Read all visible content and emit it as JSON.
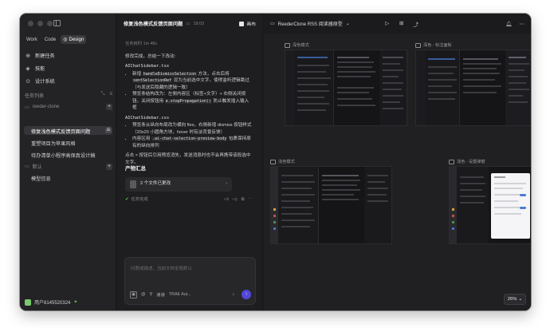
{
  "sidebar": {
    "modes": [
      {
        "label": "Work",
        "active": false
      },
      {
        "label": "Code",
        "active": false
      },
      {
        "label": "Design",
        "active": true
      }
    ],
    "nav": [
      {
        "label": "新建任务",
        "icon": "new-task-icon"
      },
      {
        "label": "技能",
        "icon": "skills-icon"
      },
      {
        "label": "设计系统",
        "icon": "design-system-icon"
      }
    ],
    "tasks_header": "任务列表",
    "groups": [
      {
        "name": "reeder-clone",
        "tasks": [
          "修复浅色模式反馈页面问题",
          "重塑项目为苹果风格",
          "待办清单小程序高保真设计稿"
        ]
      },
      {
        "name": "默认",
        "tasks": [
          "模型信息"
        ]
      }
    ],
    "user_name": "用户8145520324"
  },
  "chat": {
    "title": "修复浅色模式反馈页面问题",
    "time": "18:03",
    "flag_label": "画布",
    "elapsed": "任务耗时 1m 48s",
    "summary": "修改完成。总结一下改动:",
    "file1": "AIChatSidebar.tsx",
    "file1_items": [
      {
        "pre": "新增 ",
        "code1": "handleDismissSelection",
        "mid": " 方法，点击后将 ",
        "code2": "sentSelectionRef",
        "post": " 设为当前选中文字，使得监听逻辑跳过（与发送后隐藏的逻辑一致）"
      },
      {
        "pre": "预览条结构改为：左侧内容区（标签+文字）+ 右侧关闭按钮。关闭按钮用 ",
        "code1": "e.stopPropagation()",
        "mid": "",
        "code2": "",
        "post": " 防止触发插入输入框"
      }
    ],
    "file2": "AIChatSidebar.css",
    "file2_items": [
      {
        "pre": "预览条从纵向布局改为横向 flex。右侧新增 dismiss 按钮样式（20x20 小圆角方块，hover 时有淡背景反馈）",
        "code1": "",
        "mid": "",
        "code2": "",
        "post": ""
      },
      {
        "pre": "内容区用 ",
        "code1": ".ai-chat-selection-preview-body",
        "mid": "",
        "code2": "",
        "post": " 包裹保持原有的纵向排列"
      }
    ],
    "conclusion": "点击 × 按钮后引用预览消失，发送消息时也不会再携带该段选中文字。",
    "products_title": "产物汇总",
    "file_card": "2 个文件已更改",
    "done_label": "任务完成",
    "composer_placeholder": "问题或描述，当前文档全局默认",
    "composer_model": "TRAE Aut...",
    "composer_mode": "速速"
  },
  "preview": {
    "title": "ReederClone RSS 阅读器原型",
    "shots": [
      {
        "label": "深色模式"
      },
      {
        "label": "深色 - 标注面板"
      },
      {
        "label": "浅色模式"
      },
      {
        "label": "浅色 - 设置弹窗"
      }
    ],
    "zoom": "26%"
  }
}
